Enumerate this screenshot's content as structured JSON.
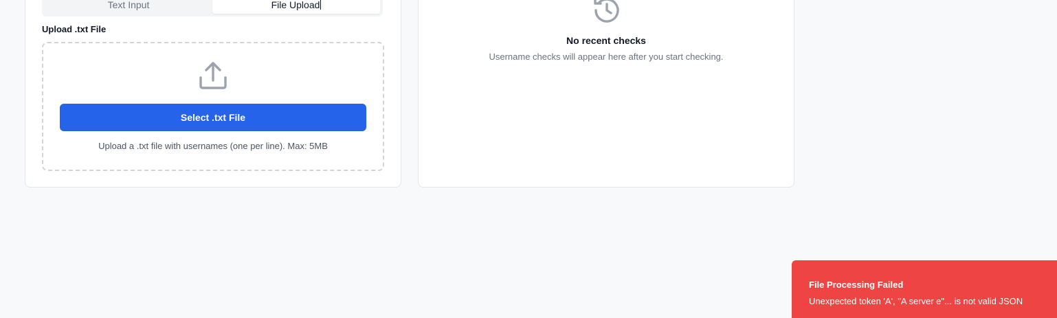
{
  "input_panel": {
    "tabs": [
      {
        "label": "Text Input",
        "active": false
      },
      {
        "label": "File Upload",
        "active": true
      }
    ],
    "upload_label": "Upload .txt File",
    "upload_icon": "upload-icon",
    "select_button_label": "Select .txt File",
    "upload_hint": "Upload a .txt file with usernames (one per line). Max: 5MB"
  },
  "recent_panel": {
    "icon": "history-icon",
    "empty_title": "No recent checks",
    "empty_subtitle": "Username checks will appear here after you start checking."
  },
  "toast": {
    "title": "File Processing Failed",
    "description": "Unexpected token 'A', \"A server e\"... is not valid JSON",
    "color": "#ef4444"
  },
  "colors": {
    "primary": "#2563eb",
    "background": "#f8f9fb",
    "error": "#ef4444"
  }
}
